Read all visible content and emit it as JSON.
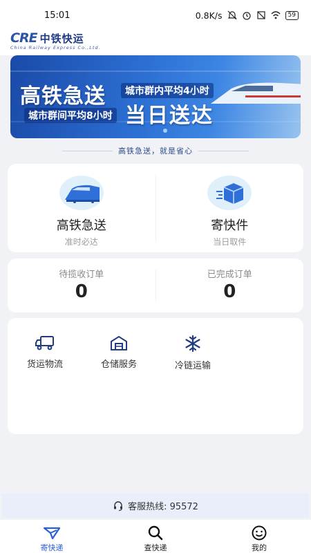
{
  "status_bar": {
    "time": "15:01",
    "net_speed": "0.8K/s",
    "battery": "59"
  },
  "header": {
    "logo_mark": "CRE",
    "logo_cn": "中铁快运",
    "logo_en": "China Railway Express Co.,Ltd."
  },
  "banner": {
    "title1": "高铁急送",
    "sub1": "城市群内平均4小时",
    "sub2": "城市群间平均8小时",
    "title2": "当日送达"
  },
  "slogan": "高铁急送，就是省心",
  "services": [
    {
      "title": "高铁急送",
      "subtitle": "准时必达",
      "icon": "train-icon"
    },
    {
      "title": "寄快件",
      "subtitle": "当日取件",
      "icon": "package-icon"
    }
  ],
  "stats": [
    {
      "label": "待揽收订单",
      "value": "0"
    },
    {
      "label": "已完成订单",
      "value": "0"
    }
  ],
  "grid": [
    {
      "label": "货运物流",
      "icon": "truck-icon"
    },
    {
      "label": "仓储服务",
      "icon": "warehouse-icon"
    },
    {
      "label": "冷链运输",
      "icon": "snowflake-icon"
    }
  ],
  "hotline": {
    "label": "客服热线: 95572"
  },
  "tabs": [
    {
      "label": "寄快递",
      "icon": "send-icon",
      "active": true
    },
    {
      "label": "查快递",
      "icon": "search-icon",
      "active": false
    },
    {
      "label": "我的",
      "icon": "profile-icon",
      "active": false
    }
  ],
  "colors": {
    "accent": "#2a5ed8",
    "brand": "#1f3b82",
    "background": "#f1f2f6"
  }
}
